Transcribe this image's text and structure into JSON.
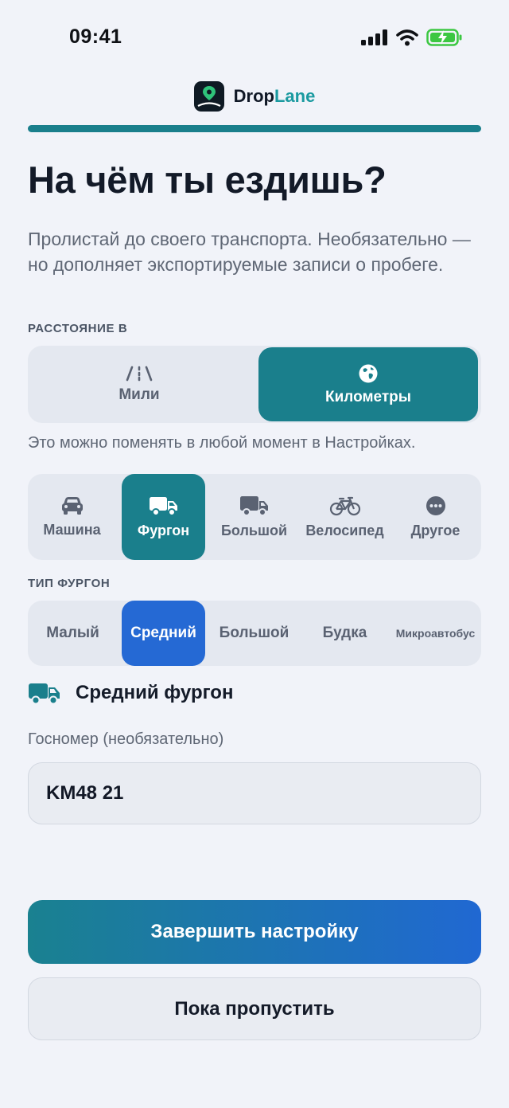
{
  "status_bar": {
    "time": "09:41"
  },
  "brand": {
    "name_part1": "Drop",
    "name_part2": "Lane"
  },
  "onboarding": {
    "progress": 1.0
  },
  "title": "На чём ты ездишь?",
  "subtitle": "Пролистай до своего транспорта. Необязательно — но дополняет экспортируемые записи о пробеге.",
  "distance": {
    "label": "РАССТОЯНИЕ В",
    "options": [
      {
        "label": "Мили",
        "icon": "road-icon",
        "selected": false
      },
      {
        "label": "Километры",
        "icon": "globe-icon",
        "selected": true
      }
    ],
    "hint": "Это можно поменять в любой момент в Настройках."
  },
  "vehicles": [
    {
      "label": "Машина",
      "icon": "car-icon",
      "selected": false
    },
    {
      "label": "Фургон",
      "icon": "van-icon",
      "selected": true
    },
    {
      "label": "Большой",
      "icon": "truck-icon",
      "selected": false
    },
    {
      "label": "Велосипед",
      "icon": "bicycle-icon",
      "selected": false
    },
    {
      "label": "Другое",
      "icon": "more-icon",
      "selected": false
    }
  ],
  "van_type": {
    "label": "ТИП ФУРГОН",
    "options": [
      {
        "label": "Малый",
        "selected": false
      },
      {
        "label": "Средний",
        "selected": true
      },
      {
        "label": "Большой",
        "selected": false
      },
      {
        "label": "Будка",
        "selected": false
      },
      {
        "label": "Микроавтобус",
        "selected": false
      }
    ]
  },
  "selected_vehicle": "Средний фургон",
  "plate": {
    "label": "Госномер (необязательно)",
    "value": "KM48 21"
  },
  "buttons": {
    "finish": "Завершить настройку",
    "skip": "Пока пропустить"
  },
  "colors": {
    "accent_teal": "#1a7f8c",
    "accent_blue": "#2569d4",
    "background": "#f1f3f9"
  }
}
